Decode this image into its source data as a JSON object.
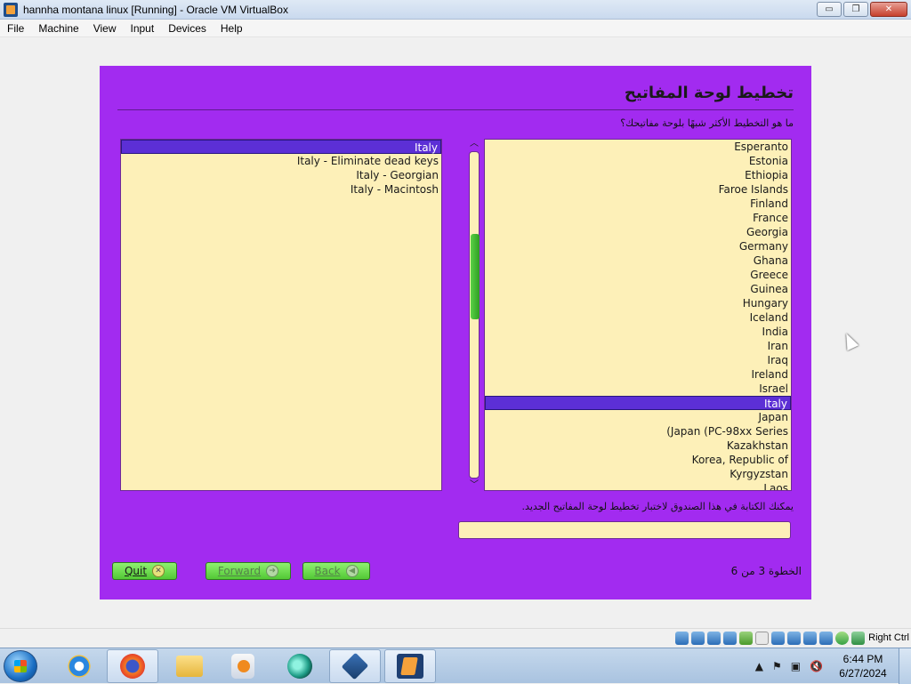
{
  "window": {
    "title": "hannha montana linux [Running] - Oracle VM VirtualBox",
    "minimize_glyph": "▭",
    "restore_glyph": "❐",
    "close_glyph": "✕"
  },
  "menu": {
    "items": [
      "File",
      "Machine",
      "View",
      "Input",
      "Devices",
      "Help"
    ]
  },
  "installer": {
    "title": "تخطيط لوحة المفاتيح",
    "question": "ما هو التخطيط الأكثر شبهًا بلوحة مفاتيحك؟",
    "variants": [
      {
        "label": "Italy",
        "selected": true
      },
      {
        "label": "Italy - Eliminate dead keys",
        "selected": false
      },
      {
        "label": "Italy - Georgian",
        "selected": false
      },
      {
        "label": "Italy - Macintosh",
        "selected": false
      }
    ],
    "countries": [
      {
        "label": "Esperanto",
        "selected": false
      },
      {
        "label": "Estonia",
        "selected": false
      },
      {
        "label": "Ethiopia",
        "selected": false
      },
      {
        "label": "Faroe Islands",
        "selected": false
      },
      {
        "label": "Finland",
        "selected": false
      },
      {
        "label": "France",
        "selected": false
      },
      {
        "label": "Georgia",
        "selected": false
      },
      {
        "label": "Germany",
        "selected": false
      },
      {
        "label": "Ghana",
        "selected": false
      },
      {
        "label": "Greece",
        "selected": false
      },
      {
        "label": "Guinea",
        "selected": false
      },
      {
        "label": "Hungary",
        "selected": false
      },
      {
        "label": "Iceland",
        "selected": false
      },
      {
        "label": "India",
        "selected": false
      },
      {
        "label": "Iran",
        "selected": false
      },
      {
        "label": "Iraq",
        "selected": false
      },
      {
        "label": "Ireland",
        "selected": false
      },
      {
        "label": "Israel",
        "selected": false
      },
      {
        "label": "Italy",
        "selected": true
      },
      {
        "label": "Japan",
        "selected": false
      },
      {
        "label": "(Japan (PC-98xx Series",
        "selected": false
      },
      {
        "label": "Kazakhstan",
        "selected": false
      },
      {
        "label": "Korea, Republic of",
        "selected": false
      },
      {
        "label": "Kyrgyzstan",
        "selected": false
      },
      {
        "label": "Laos",
        "selected": false
      }
    ],
    "scroll_up_glyph": "︿",
    "scroll_down_glyph": "﹀",
    "hint": "يمكنك الكتابة في هذا الصندوق لاختبار تخطيط لوحة المفاتيح الجديد.",
    "test_input_value": "",
    "step": "الخطوة 3 من 6",
    "buttons": {
      "quit": "Quit",
      "forward": "Forward",
      "back": "Back"
    },
    "colors": {
      "background": "#a22bf0",
      "list_background": "#fdf0b8",
      "selection": "#5c2fd6",
      "button": "#6fdc52"
    }
  },
  "statusbar": {
    "host_key": "Right Ctrl"
  },
  "taskbar": {
    "apps": [
      "internet-explorer",
      "firefox",
      "file-explorer",
      "media-player",
      "fish-app",
      "virtualbox",
      "virtualbox-vm"
    ],
    "tray": {
      "time": "6:44 PM",
      "date": "6/27/2024",
      "show_hidden_glyph": "▲",
      "flag_glyph": "⚑",
      "network_glyph": "▣",
      "volume_glyph": "🔇"
    }
  }
}
